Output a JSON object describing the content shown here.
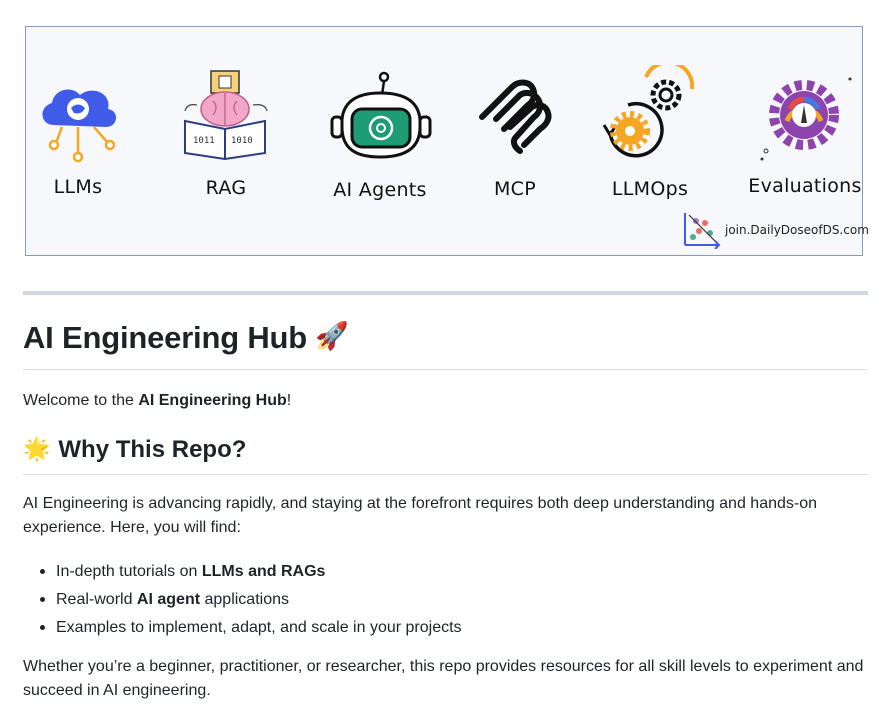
{
  "banner": {
    "items": [
      {
        "label": "LLMs",
        "icon": "cloud-whale-icon"
      },
      {
        "label": "RAG",
        "icon": "brain-book-icon"
      },
      {
        "label": "AI Agents",
        "icon": "robot-icon"
      },
      {
        "label": "MCP",
        "icon": "mcp-logo-icon"
      },
      {
        "label": "LLMOps",
        "icon": "gears-cycle-icon"
      },
      {
        "label": "Evaluations",
        "icon": "gauge-gear-icon"
      }
    ],
    "watermark": "join.DailyDoseofDS.com",
    "colors": {
      "llm_blue": "#3f5be8",
      "robot_green": "#1e9c74",
      "orange": "#f5a623",
      "purple": "#8e44ad",
      "frame": "#8a9bbd"
    }
  },
  "title": {
    "text": "AI Engineering Hub",
    "emoji": "🚀"
  },
  "welcome": {
    "prefix": "Welcome to the ",
    "bold": "AI Engineering Hub",
    "suffix": "!"
  },
  "why": {
    "emoji": "🌟",
    "heading": "Why This Repo?",
    "intro": "AI Engineering is advancing rapidly, and staying at the forefront requires both deep understanding and hands-on experience. Here, you will find:",
    "bullets": [
      {
        "pre": "In-depth tutorials on ",
        "bold": "LLMs and RAGs",
        "post": ""
      },
      {
        "pre": "Real-world ",
        "bold": "AI agent",
        "post": " applications"
      },
      {
        "pre": "Examples to implement, adapt, and scale in your projects",
        "bold": "",
        "post": ""
      }
    ],
    "closing": "Whether you’re a beginner, practitioner, or researcher, this repo provides resources for all skill levels to experiment and succeed in AI engineering."
  }
}
